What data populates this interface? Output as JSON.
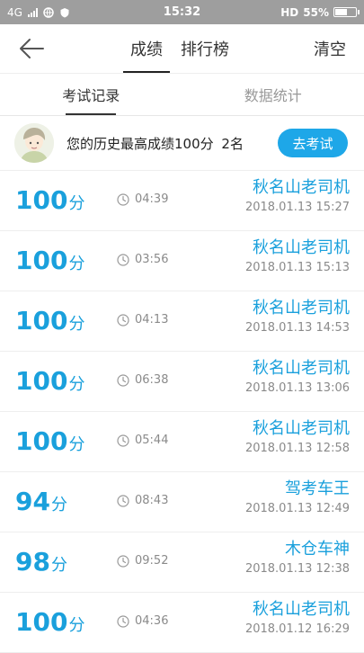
{
  "status_bar": {
    "network": "4G",
    "time": "15:32",
    "hd": "HD",
    "battery": "55%"
  },
  "nav": {
    "tabs": [
      {
        "label": "成绩"
      },
      {
        "label": "排行榜"
      }
    ],
    "clear_label": "清空"
  },
  "sub_tabs": [
    {
      "label": "考试记录"
    },
    {
      "label": "数据统计"
    }
  ],
  "summary": {
    "text": "您的历史最高成绩100分",
    "rank": "2名",
    "button": "去考试"
  },
  "records": [
    {
      "score": "100",
      "unit": "分",
      "duration": "04:39",
      "name": "秋名山老司机",
      "datetime": "2018.01.13  15:27"
    },
    {
      "score": "100",
      "unit": "分",
      "duration": "03:56",
      "name": "秋名山老司机",
      "datetime": "2018.01.13  15:13"
    },
    {
      "score": "100",
      "unit": "分",
      "duration": "04:13",
      "name": "秋名山老司机",
      "datetime": "2018.01.13  14:53"
    },
    {
      "score": "100",
      "unit": "分",
      "duration": "06:38",
      "name": "秋名山老司机",
      "datetime": "2018.01.13  13:06"
    },
    {
      "score": "100",
      "unit": "分",
      "duration": "05:44",
      "name": "秋名山老司机",
      "datetime": "2018.01.13  12:58"
    },
    {
      "score": "94",
      "unit": "分",
      "duration": "08:43",
      "name": "驾考车王",
      "datetime": "2018.01.13  12:49"
    },
    {
      "score": "98",
      "unit": "分",
      "duration": "09:52",
      "name": "木仓车神",
      "datetime": "2018.01.13  12:38"
    },
    {
      "score": "100",
      "unit": "分",
      "duration": "04:36",
      "name": "秋名山老司机",
      "datetime": "2018.01.12  16:29"
    }
  ],
  "colors": {
    "accent": "#1aa0dc",
    "button": "#1ea7e8",
    "status_bar": "#9e9e9e"
  },
  "icons": {
    "back": "arrow-left-icon",
    "clock": "clock-icon",
    "battery": "battery-icon"
  }
}
